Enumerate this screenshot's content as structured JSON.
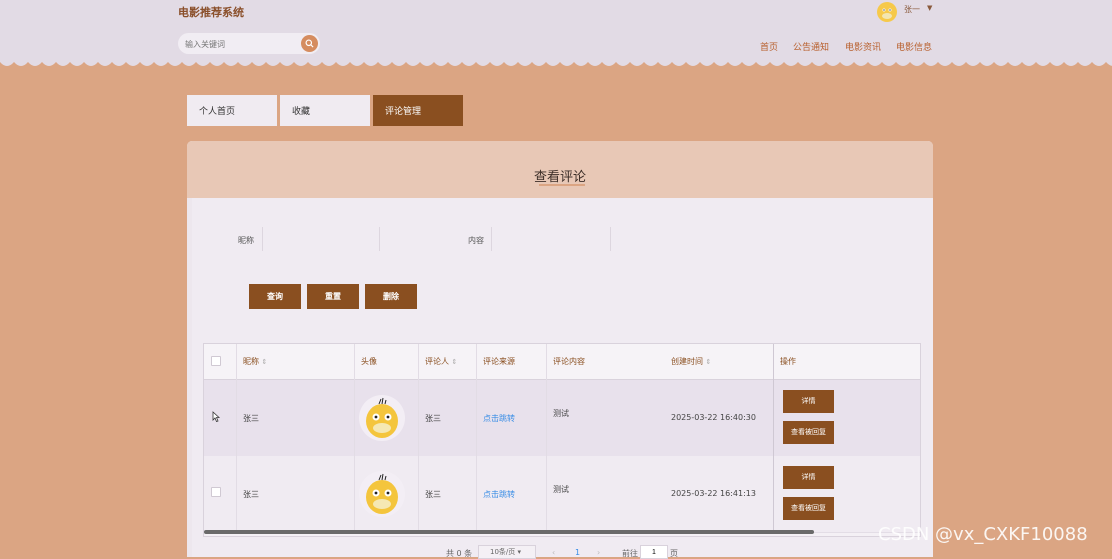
{
  "app": {
    "title": "电影推荐系统"
  },
  "search": {
    "placeholder": "输入关键词"
  },
  "user": {
    "name": "张一"
  },
  "nav": [
    "首页",
    "公告通知",
    "电影资讯",
    "电影信息"
  ],
  "tabs": [
    "个人首页",
    "收藏",
    "评论管理"
  ],
  "panel": {
    "title": "查看评论"
  },
  "filters": {
    "nickname_label": "昵称",
    "content_label": "内容",
    "nickname_value": "",
    "content_value": ""
  },
  "buttons": {
    "query": "查询",
    "reset": "重置",
    "delete": "删除"
  },
  "table": {
    "columns": [
      "昵称",
      "头像",
      "评论人",
      "评论来源",
      "评论内容",
      "创建时间",
      "操作"
    ],
    "rows": [
      {
        "nickname": "张三",
        "commenter": "张三",
        "source": "点击跳转",
        "content": "测试",
        "created": "2025-03-22 16:40:30",
        "detail": "详情",
        "reply": "查看被回复"
      },
      {
        "nickname": "张三",
        "commenter": "张三",
        "source": "点击跳转",
        "content": "测试",
        "created": "2025-03-22 16:41:13",
        "detail": "详情",
        "reply": "查看被回复"
      }
    ]
  },
  "pagination": {
    "total": "共 0 条",
    "page_size": "10条/页",
    "prev": "‹",
    "current": "1",
    "next": "›",
    "goto_label": "前往",
    "goto_value": "1",
    "page_suffix": "页"
  },
  "watermark": "CSDN @vx_CXKF10088",
  "colors": {
    "accent": "#8a4f20",
    "background": "#dba583",
    "header": "#e2dbe5",
    "link": "#3a8ee6"
  }
}
